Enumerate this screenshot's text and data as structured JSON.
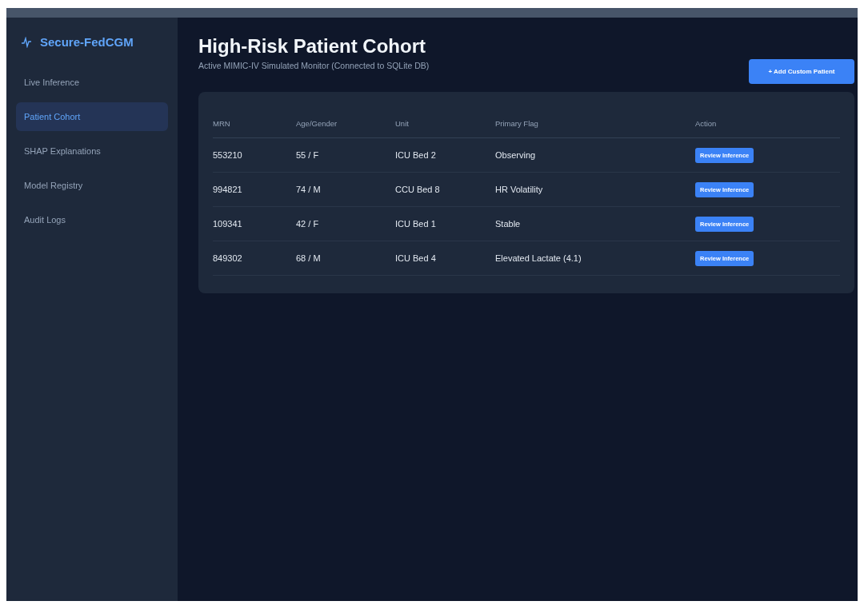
{
  "brand": {
    "name": "Secure-FedCGM"
  },
  "sidebar": {
    "items": [
      {
        "label": "Live Inference",
        "selected": false
      },
      {
        "label": "Patient Cohort",
        "selected": true
      },
      {
        "label": "SHAP Explanations",
        "selected": false
      },
      {
        "label": "Model Registry",
        "selected": false
      },
      {
        "label": "Audit Logs",
        "selected": false
      }
    ]
  },
  "header": {
    "title": "High-Risk Patient Cohort",
    "subtitle": "Active MIMIC-IV Simulated Monitor (Connected to SQLite DB)",
    "button": "+ Add Custom Patient"
  },
  "table": {
    "columns": [
      "MRN",
      "Age/Gender",
      "Unit",
      "Primary Flag",
      "Action"
    ],
    "rows": [
      {
        "mrn": "553210",
        "age_gender": "55 / F",
        "unit": "ICU Bed 2",
        "flag": "Observing",
        "action": "Review Inference"
      },
      {
        "mrn": "994821",
        "age_gender": "74 / M",
        "unit": "CCU Bed 8",
        "flag": "HR Volatility",
        "action": "Review Inference"
      },
      {
        "mrn": "109341",
        "age_gender": "42 / F",
        "unit": "ICU Bed 1",
        "flag": "Stable",
        "action": "Review Inference"
      },
      {
        "mrn": "849302",
        "age_gender": "68 / M",
        "unit": "ICU Bed 4",
        "flag": "Elevated Lactate (4.1)",
        "action": "Review Inference"
      }
    ]
  }
}
